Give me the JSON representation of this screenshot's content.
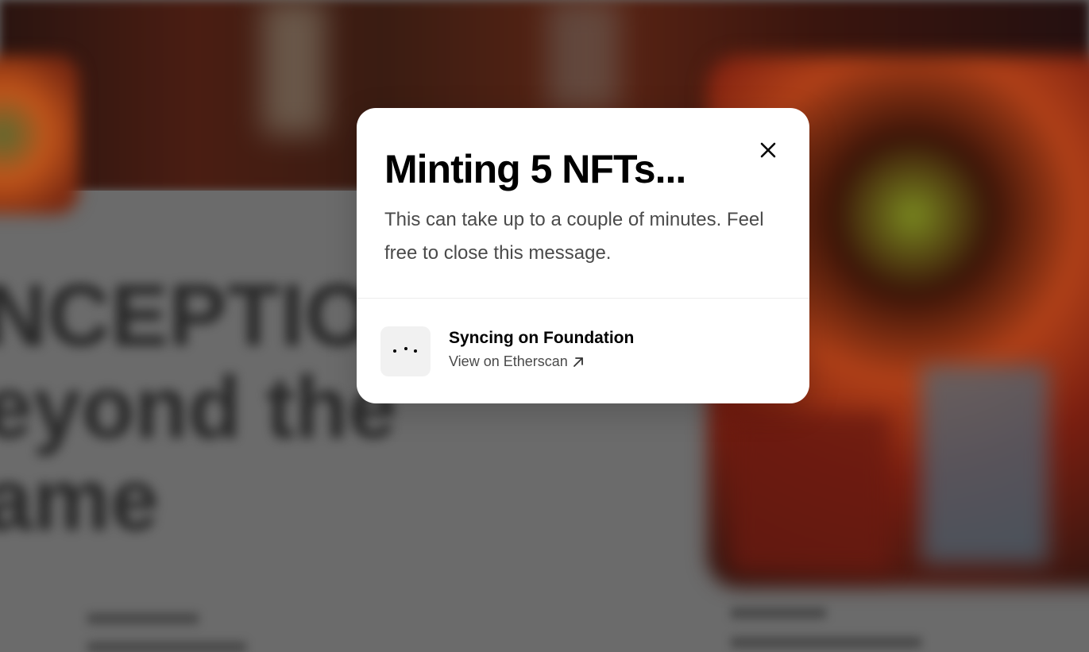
{
  "background": {
    "headline_lines": [
      "NCEPTION",
      "eyond the",
      "ame"
    ]
  },
  "modal": {
    "title": "Minting 5 NFTs...",
    "description": "This can take up to a couple of minutes. Feel free to close this message.",
    "close_icon": "close-icon",
    "status": {
      "icon": "loading-dots-icon",
      "title": "Syncing on Foundation",
      "link_label": "View on Etherscan",
      "link_icon": "arrow-up-right-icon"
    }
  }
}
